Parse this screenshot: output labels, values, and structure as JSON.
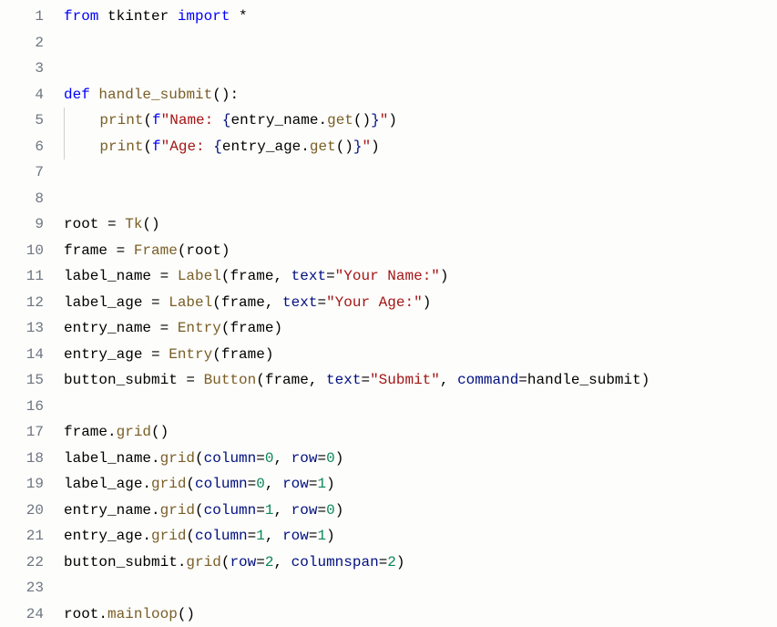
{
  "lines": [
    {
      "n": "1",
      "tokens": [
        [
          "kw",
          "from"
        ],
        [
          "",
          " tkinter "
        ],
        [
          "kw",
          "import"
        ],
        [
          "",
          " *"
        ]
      ]
    },
    {
      "n": "2",
      "tokens": []
    },
    {
      "n": "3",
      "tokens": []
    },
    {
      "n": "4",
      "tokens": [
        [
          "kw",
          "def"
        ],
        [
          "",
          " "
        ],
        [
          "fn",
          "handle_submit"
        ],
        [
          "",
          "():"
        ]
      ]
    },
    {
      "n": "5",
      "tokens": [
        [
          "",
          "    "
        ],
        [
          "fn",
          "print"
        ],
        [
          "",
          "("
        ],
        [
          "kw",
          "f"
        ],
        [
          "s",
          "\"Name: "
        ],
        [
          "decl",
          "{"
        ],
        [
          "",
          "entry_name."
        ],
        [
          "fn",
          "get"
        ],
        [
          "",
          "()"
        ],
        [
          "decl",
          "}"
        ],
        [
          "s",
          "\""
        ],
        [
          "",
          ")"
        ]
      ]
    },
    {
      "n": "6",
      "tokens": [
        [
          "",
          "    "
        ],
        [
          "fn",
          "print"
        ],
        [
          "",
          "("
        ],
        [
          "kw",
          "f"
        ],
        [
          "s",
          "\"Age: "
        ],
        [
          "decl",
          "{"
        ],
        [
          "",
          "entry_age."
        ],
        [
          "fn",
          "get"
        ],
        [
          "",
          "()"
        ],
        [
          "decl",
          "}"
        ],
        [
          "s",
          "\""
        ],
        [
          "",
          ")"
        ]
      ]
    },
    {
      "n": "7",
      "tokens": []
    },
    {
      "n": "8",
      "tokens": []
    },
    {
      "n": "9",
      "tokens": [
        [
          "",
          "root = "
        ],
        [
          "fn",
          "Tk"
        ],
        [
          "",
          "()"
        ]
      ]
    },
    {
      "n": "10",
      "tokens": [
        [
          "",
          "frame = "
        ],
        [
          "fn",
          "Frame"
        ],
        [
          "",
          "(root)"
        ]
      ]
    },
    {
      "n": "11",
      "tokens": [
        [
          "",
          "label_name = "
        ],
        [
          "fn",
          "Label"
        ],
        [
          "",
          "(frame, "
        ],
        [
          "decl",
          "text"
        ],
        [
          "",
          "="
        ],
        [
          "s",
          "\"Your Name:\""
        ],
        [
          "",
          ")"
        ]
      ]
    },
    {
      "n": "12",
      "tokens": [
        [
          "",
          "label_age = "
        ],
        [
          "fn",
          "Label"
        ],
        [
          "",
          "(frame, "
        ],
        [
          "decl",
          "text"
        ],
        [
          "",
          "="
        ],
        [
          "s",
          "\"Your Age:\""
        ],
        [
          "",
          ")"
        ]
      ]
    },
    {
      "n": "13",
      "tokens": [
        [
          "",
          "entry_name = "
        ],
        [
          "fn",
          "Entry"
        ],
        [
          "",
          "(frame)"
        ]
      ]
    },
    {
      "n": "14",
      "tokens": [
        [
          "",
          "entry_age = "
        ],
        [
          "fn",
          "Entry"
        ],
        [
          "",
          "(frame)"
        ]
      ]
    },
    {
      "n": "15",
      "tokens": [
        [
          "",
          "button_submit = "
        ],
        [
          "fn",
          "Button"
        ],
        [
          "",
          "(frame, "
        ],
        [
          "decl",
          "text"
        ],
        [
          "",
          "="
        ],
        [
          "s",
          "\"Submit\""
        ],
        [
          "",
          ", "
        ],
        [
          "decl",
          "command"
        ],
        [
          "",
          "=handle_submit)"
        ]
      ]
    },
    {
      "n": "16",
      "tokens": []
    },
    {
      "n": "17",
      "tokens": [
        [
          "",
          "frame."
        ],
        [
          "fn",
          "grid"
        ],
        [
          "",
          "()"
        ]
      ]
    },
    {
      "n": "18",
      "tokens": [
        [
          "",
          "label_name."
        ],
        [
          "fn",
          "grid"
        ],
        [
          "",
          "("
        ],
        [
          "decl",
          "column"
        ],
        [
          "",
          "="
        ],
        [
          "num",
          "0"
        ],
        [
          "",
          ", "
        ],
        [
          "decl",
          "row"
        ],
        [
          "",
          "="
        ],
        [
          "num",
          "0"
        ],
        [
          "",
          ")"
        ]
      ]
    },
    {
      "n": "19",
      "tokens": [
        [
          "",
          "label_age."
        ],
        [
          "fn",
          "grid"
        ],
        [
          "",
          "("
        ],
        [
          "decl",
          "column"
        ],
        [
          "",
          "="
        ],
        [
          "num",
          "0"
        ],
        [
          "",
          ", "
        ],
        [
          "decl",
          "row"
        ],
        [
          "",
          "="
        ],
        [
          "num",
          "1"
        ],
        [
          "",
          ")"
        ]
      ]
    },
    {
      "n": "20",
      "tokens": [
        [
          "",
          "entry_name."
        ],
        [
          "fn",
          "grid"
        ],
        [
          "",
          "("
        ],
        [
          "decl",
          "column"
        ],
        [
          "",
          "="
        ],
        [
          "num",
          "1"
        ],
        [
          "",
          ", "
        ],
        [
          "decl",
          "row"
        ],
        [
          "",
          "="
        ],
        [
          "num",
          "0"
        ],
        [
          "",
          ")"
        ]
      ]
    },
    {
      "n": "21",
      "tokens": [
        [
          "",
          "entry_age."
        ],
        [
          "fn",
          "grid"
        ],
        [
          "",
          "("
        ],
        [
          "decl",
          "column"
        ],
        [
          "",
          "="
        ],
        [
          "num",
          "1"
        ],
        [
          "",
          ", "
        ],
        [
          "decl",
          "row"
        ],
        [
          "",
          "="
        ],
        [
          "num",
          "1"
        ],
        [
          "",
          ")"
        ]
      ]
    },
    {
      "n": "22",
      "tokens": [
        [
          "",
          "button_submit."
        ],
        [
          "fn",
          "grid"
        ],
        [
          "",
          "("
        ],
        [
          "decl",
          "row"
        ],
        [
          "",
          "="
        ],
        [
          "num",
          "2"
        ],
        [
          "",
          ", "
        ],
        [
          "decl",
          "columnspan"
        ],
        [
          "",
          "="
        ],
        [
          "num",
          "2"
        ],
        [
          "",
          ")"
        ]
      ]
    },
    {
      "n": "23",
      "tokens": []
    },
    {
      "n": "24",
      "tokens": [
        [
          "",
          "root."
        ],
        [
          "fn",
          "mainloop"
        ],
        [
          "",
          "()"
        ]
      ]
    }
  ],
  "indent_guide_lines": [
    5,
    6
  ]
}
